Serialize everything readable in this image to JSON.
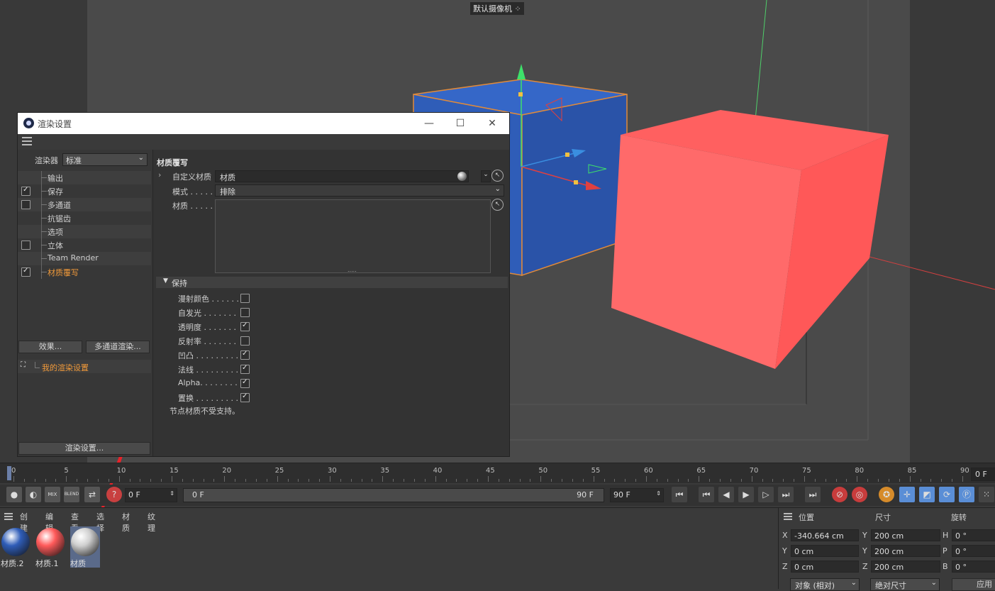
{
  "viewport": {
    "camera_label": "默认摄像机",
    "camera_icon": "camera-icon"
  },
  "dialog": {
    "title": "渲染设置",
    "app_icon": "cinema4d-logo-icon",
    "minimize_icon": "minimize-icon",
    "maximize_icon": "maximize-icon",
    "close_icon": "close-icon",
    "menu_icon": "hamburger-menu-icon",
    "renderer_label": "渲染器",
    "renderer_value": "标准",
    "tree": [
      {
        "label": "输出",
        "checkbox": null,
        "active": false
      },
      {
        "label": "保存",
        "checkbox": true,
        "active": false
      },
      {
        "label": "多通道",
        "checkbox": false,
        "active": false
      },
      {
        "label": "抗锯齿",
        "checkbox": null,
        "active": false
      },
      {
        "label": "选项",
        "checkbox": null,
        "active": false
      },
      {
        "label": "立体",
        "checkbox": false,
        "active": false
      },
      {
        "label": "Team Render",
        "checkbox": null,
        "active": false
      },
      {
        "label": "材质覆写",
        "checkbox": true,
        "active": true
      }
    ],
    "effects_button": "效果...",
    "multipass_button": "多通道渲染...",
    "preset_label": "我的渲染设置",
    "render_settings_button": "渲染设置...",
    "section_title": "材质覆写",
    "custom_material_label": "自定义材质",
    "custom_material_value": "材质",
    "mode_label": "模式 . . . . . . .",
    "mode_value": "排除",
    "material_label": "材质 . . . . . . .",
    "keep_section": "保持",
    "keep_items": [
      {
        "label": "漫射颜色 . . . . . .",
        "checked": false
      },
      {
        "label": "自发光 . . . . . . .",
        "checked": false
      },
      {
        "label": "透明度 . . . . . . .",
        "checked": true
      },
      {
        "label": "反射率 . . . . . . .",
        "checked": false
      },
      {
        "label": "凹凸 . . . . . . . . .",
        "checked": true
      },
      {
        "label": "法线 . . . . . . . . .",
        "checked": true
      },
      {
        "label": "Alpha. . . . . . . .",
        "checked": true
      },
      {
        "label": "置换 . . . . . . . . .",
        "checked": true
      }
    ],
    "note": "节点材质不受支持。"
  },
  "timeline": {
    "ticks": [
      "0",
      "5",
      "10",
      "15",
      "20",
      "25",
      "30",
      "35",
      "40",
      "45",
      "50",
      "55",
      "60",
      "65",
      "70",
      "75",
      "80",
      "85",
      "90"
    ],
    "end_field": "0 F"
  },
  "transport": {
    "current_frame": "0 F",
    "range_start": "0 F",
    "range_end": "90 F",
    "max_frame": "90 F"
  },
  "material_manager": {
    "menu": [
      "创建",
      "编辑",
      "查看",
      "选择",
      "材质",
      "纹理"
    ],
    "materials": [
      {
        "name": "材质.2",
        "color": "#2f5db8"
      },
      {
        "name": "材质.1",
        "color": "#ff5a5a"
      },
      {
        "name": "材质",
        "color": "#cfcfcf"
      }
    ]
  },
  "coordinates": {
    "headers": [
      "位置",
      "尺寸",
      "旋转"
    ],
    "rows": [
      {
        "axis": "X",
        "pos": "-340.664 cm",
        "size_axis": "Y",
        "size": "200 cm",
        "rot_axis": "H",
        "rot": "0 °"
      },
      {
        "axis": "Y",
        "pos": "0 cm",
        "size_axis": "Y",
        "size": "200 cm",
        "rot_axis": "P",
        "rot": "0 °"
      },
      {
        "axis": "Z",
        "pos": "0 cm",
        "size_axis": "Z",
        "size": "200 cm",
        "rot_axis": "B",
        "rot": "0 °"
      }
    ],
    "mode_object": "对象 (相对)",
    "mode_size": "绝对尺寸",
    "apply_button": "应用"
  },
  "colors": {
    "accent_orange": "#f19a3a",
    "cube_blue": "#2f5db8",
    "cube_red": "#ff6a6a",
    "annotation_arrow": "#e8232a"
  }
}
